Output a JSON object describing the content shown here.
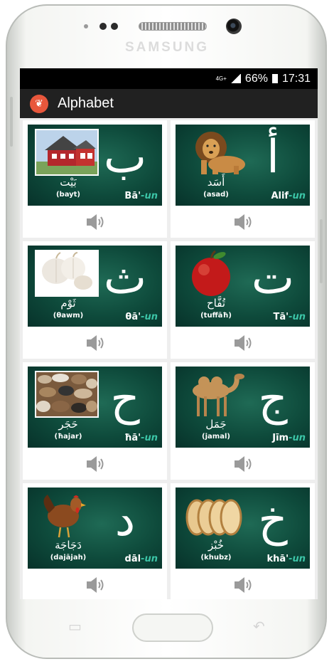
{
  "device": {
    "brand": "SAMSUNG"
  },
  "statusbar": {
    "network": "4G+",
    "battery": "66%",
    "time": "17:31"
  },
  "appbar": {
    "icon": "app-logo-icon",
    "title": "Alphabet"
  },
  "letters": [
    {
      "word_ar": "بَيْت",
      "translit": "(bayt)",
      "letter": "ب",
      "name": "Bā'",
      "suffix": "-un",
      "image": "house"
    },
    {
      "word_ar": "أَسَد",
      "translit": "(asad)",
      "letter": "أ",
      "name": "Alif",
      "suffix": "-un",
      "image": "lion"
    },
    {
      "word_ar": "ثَوْم",
      "translit": "(θawm)",
      "letter": "ث",
      "name": "θā'",
      "suffix": "-un",
      "image": "garlic"
    },
    {
      "word_ar": "تُفَّاح",
      "translit": "(tuffāħ)",
      "letter": "ت",
      "name": "Tā'",
      "suffix": "-un",
      "image": "apple"
    },
    {
      "word_ar": "حَجَر",
      "translit": "(ħajar)",
      "letter": "ح",
      "name": "ħā'",
      "suffix": "-un",
      "image": "stones"
    },
    {
      "word_ar": "جَمَل",
      "translit": "(jamal)",
      "letter": "ج",
      "name": "Jīm",
      "suffix": "-un",
      "image": "camel"
    },
    {
      "word_ar": "دَجَاجَة",
      "translit": "(dajājah)",
      "letter": "د",
      "name": "dāl",
      "suffix": "-un",
      "image": "hen"
    },
    {
      "word_ar": "خُبْز",
      "translit": "(khubz)",
      "letter": "خ",
      "name": "khā'",
      "suffix": "-un",
      "image": "bread"
    }
  ],
  "colors": {
    "card_green": "#0e4a3b",
    "suffix_teal": "#3cc6a8",
    "appbar": "#212121",
    "app_icon": "#e8573c"
  }
}
